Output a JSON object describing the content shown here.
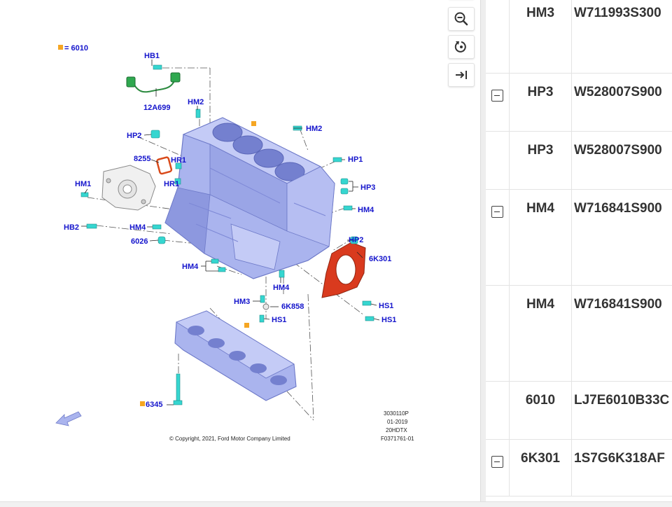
{
  "diagram": {
    "legend": {
      "label": "= 6010",
      "color": "#f5a623"
    },
    "labels": {
      "hb1": "HB1",
      "c12a699": "12A699",
      "hm2_a": "HM2",
      "hm2_b": "HM2",
      "hp2_a": "HP2",
      "c8255": "8255",
      "hr1_a": "HR1",
      "hr1_b": "HR1",
      "hm1": "HM1",
      "hb2": "HB2",
      "hm4_a": "HM4",
      "c6026": "6026",
      "hp1": "HP1",
      "hp3": "HP3",
      "hm4_b": "HM4",
      "hp2_b": "HP2",
      "c6k301": "6K301",
      "hm4_c": "HM4",
      "hm4_d": "HM4",
      "hm3": "HM3",
      "c6k858": "6K858",
      "hs1_a": "HS1",
      "hs1_b": "HS1",
      "hs1_c": "HS1",
      "c6345": "6345"
    },
    "info_lines": [
      "3030110P",
      "01-2019",
      "20HDTX",
      "F0371761-01"
    ],
    "copyright": "© Copyright, 2021, Ford Motor Company Limited",
    "colors": {
      "block": "#aab4ee",
      "label": "#1414cc",
      "seal": "#d93a1e",
      "bolt": "#36d6d0",
      "sensor": "#2fa84f",
      "marker": "#f5a623"
    }
  },
  "toolbar": {
    "buttons": [
      {
        "name": "zoom-out",
        "icon": "zoom-out-icon"
      },
      {
        "name": "reset",
        "icon": "reset-icon"
      },
      {
        "name": "collapse",
        "icon": "collapse-right-icon"
      }
    ]
  },
  "parts": {
    "rows": [
      {
        "ref": "HM3",
        "part": "W711993S300",
        "toggle": false
      },
      {
        "ref": "HP3",
        "part": "W528007S900",
        "toggle": true
      },
      {
        "ref": "HP3",
        "part": "W528007S900",
        "toggle": false
      },
      {
        "ref": "HM4",
        "part": "W716841S900",
        "toggle": true
      },
      {
        "ref": "HM4",
        "part": "W716841S900",
        "toggle": false
      },
      {
        "ref": "6010",
        "part": "LJ7E6010B33C",
        "toggle": false
      },
      {
        "ref": "6K301",
        "part": "1S7G6K318AF",
        "toggle": true
      }
    ]
  }
}
